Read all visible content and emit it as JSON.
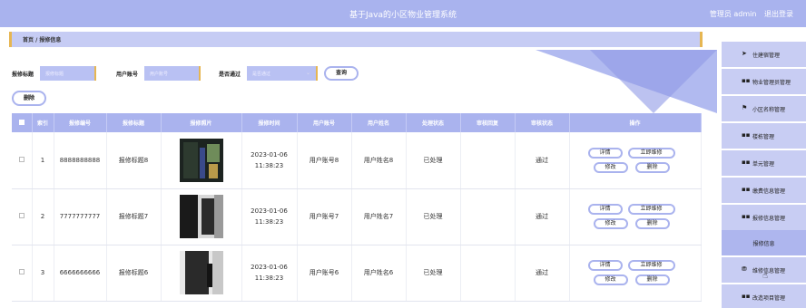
{
  "header": {
    "title": "基于Java的小区物业管理系统",
    "user_role": "管理员 admin",
    "logout": "退出登录"
  },
  "breadcrumb": {
    "text": "首页 / 报修信息"
  },
  "filters": {
    "title_label": "报修标题",
    "title_placeholder": "报修标题",
    "account_label": "用户账号",
    "account_placeholder": "用户账号",
    "passed_label": "是否通过",
    "passed_placeholder": "是否通过",
    "search_button": "查询"
  },
  "actions": {
    "delete_button": "删除"
  },
  "table": {
    "columns": [
      "索引",
      "报修编号",
      "报修标题",
      "报修照片",
      "报修时间",
      "用户账号",
      "用户姓名",
      "处理状态",
      "审核回复",
      "审核状态",
      "操作"
    ],
    "rows": [
      {
        "index": "1",
        "repair_no": "8888888888",
        "title": "报修标题8",
        "time": "2023-01-06 11:38:23",
        "account": "用户账号8",
        "name": "用户姓名8",
        "status": "已处理",
        "reply": "",
        "audit": "通过"
      },
      {
        "index": "2",
        "repair_no": "7777777777",
        "title": "报修标题7",
        "time": "2023-01-06 11:38:23",
        "account": "用户账号7",
        "name": "用户姓名7",
        "status": "已处理",
        "reply": "",
        "audit": "通过"
      },
      {
        "index": "3",
        "repair_no": "6666666666",
        "title": "报修标题6",
        "time": "2023-01-06 11:38:23",
        "account": "用户账号6",
        "name": "用户姓名6",
        "status": "已处理",
        "reply": "",
        "audit": "通过"
      }
    ],
    "ops": {
      "detail": "详情",
      "repair_now": "立即维修",
      "edit": "修改",
      "delete": "删除"
    }
  },
  "sidebar": {
    "items": [
      {
        "icon": "send-icon",
        "label": "住建宿管理"
      },
      {
        "icon": "grid-icon",
        "label": "物业管理员管理"
      },
      {
        "icon": "flag-icon",
        "label": "小区名称管理"
      },
      {
        "icon": "grid-icon",
        "label": "楼栋管理"
      },
      {
        "icon": "grid-icon",
        "label": "单元管理"
      },
      {
        "icon": "grid-icon",
        "label": "缴费信息管理"
      },
      {
        "icon": "grid-icon",
        "label": "报修信息管理"
      },
      {
        "icon": "",
        "label": "报修信息"
      },
      {
        "icon": "coin-icon",
        "label": "维修信息管理"
      },
      {
        "icon": "grid-icon",
        "label": "改造项目管理"
      }
    ]
  },
  "colors": {
    "accent": "#aab3ee",
    "sidebar_bg": "#c8cdf3",
    "highlight": "#e6b652"
  }
}
